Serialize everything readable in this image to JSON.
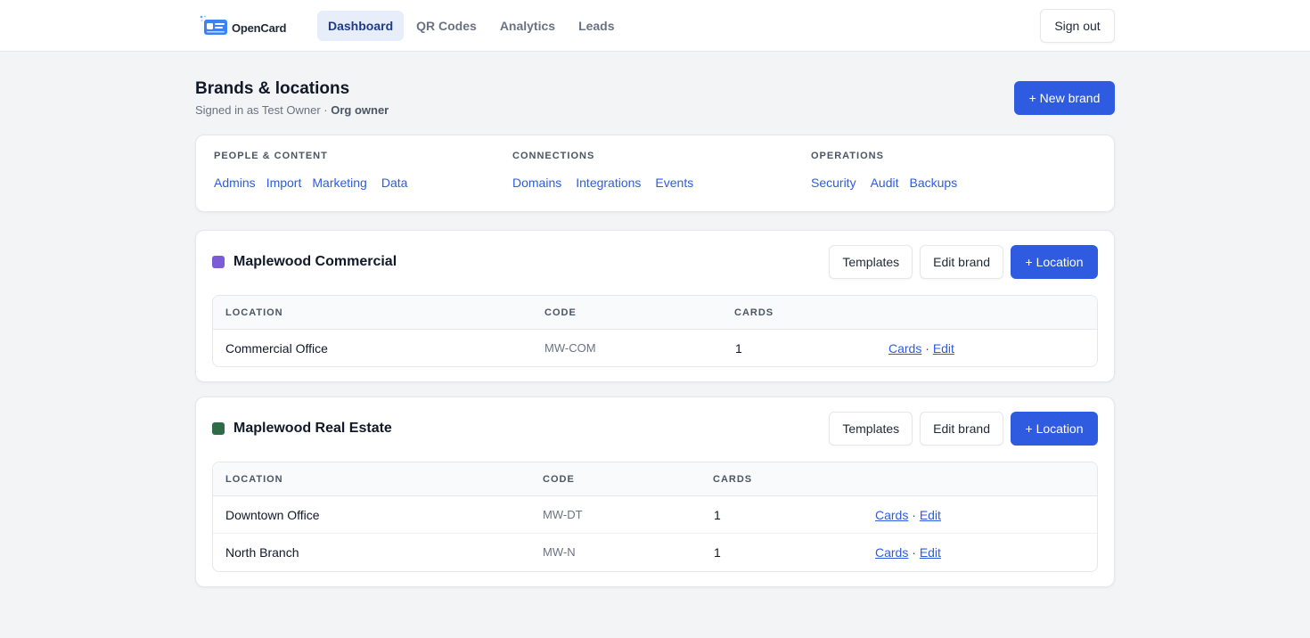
{
  "app": {
    "name": "OpenCard"
  },
  "nav": {
    "items": [
      {
        "label": "Dashboard",
        "active": true
      },
      {
        "label": "QR Codes",
        "active": false
      },
      {
        "label": "Analytics",
        "active": false
      },
      {
        "label": "Leads",
        "active": false
      }
    ],
    "sign_out": "Sign out"
  },
  "page": {
    "title": "Brands & locations",
    "signed_in_prefix": "Signed in as Test Owner · ",
    "role": "Org owner",
    "new_brand": "+ New brand"
  },
  "quicklinks": {
    "groups": [
      {
        "heading": "PEOPLE & CONTENT",
        "links": [
          "Admins",
          "Import",
          "Marketing",
          "Data"
        ]
      },
      {
        "heading": "CONNECTIONS",
        "links": [
          "Domains",
          "Integrations",
          "Events"
        ]
      },
      {
        "heading": "OPERATIONS",
        "links": [
          "Security",
          "Audit",
          "Backups"
        ]
      }
    ]
  },
  "brands": [
    {
      "name": "Maplewood Commercial",
      "color": "#7c5cd6",
      "actions": {
        "templates": "Templates",
        "edit": "Edit brand",
        "add_location": "+ Location"
      },
      "columns": [
        "LOCATION",
        "CODE",
        "CARDS"
      ],
      "rows": [
        {
          "location": "Commercial Office",
          "code": "MW-COM",
          "cards": "1",
          "link_cards": "Cards",
          "sep": " · ",
          "link_edit": "Edit"
        }
      ]
    },
    {
      "name": "Maplewood Real Estate",
      "color": "#2e6b47",
      "actions": {
        "templates": "Templates",
        "edit": "Edit brand",
        "add_location": "+ Location"
      },
      "columns": [
        "LOCATION",
        "CODE",
        "CARDS"
      ],
      "rows": [
        {
          "location": "Downtown Office",
          "code": "MW-DT",
          "cards": "1",
          "link_cards": "Cards",
          "sep": " · ",
          "link_edit": "Edit"
        },
        {
          "location": "North Branch",
          "code": "MW-N",
          "cards": "1",
          "link_cards": "Cards",
          "sep": " · ",
          "link_edit": "Edit"
        }
      ]
    }
  ],
  "colors": {
    "accent": "#2f5be0",
    "nav_active_bg": "#e8eef9",
    "page_bg": "#f3f4f6"
  }
}
